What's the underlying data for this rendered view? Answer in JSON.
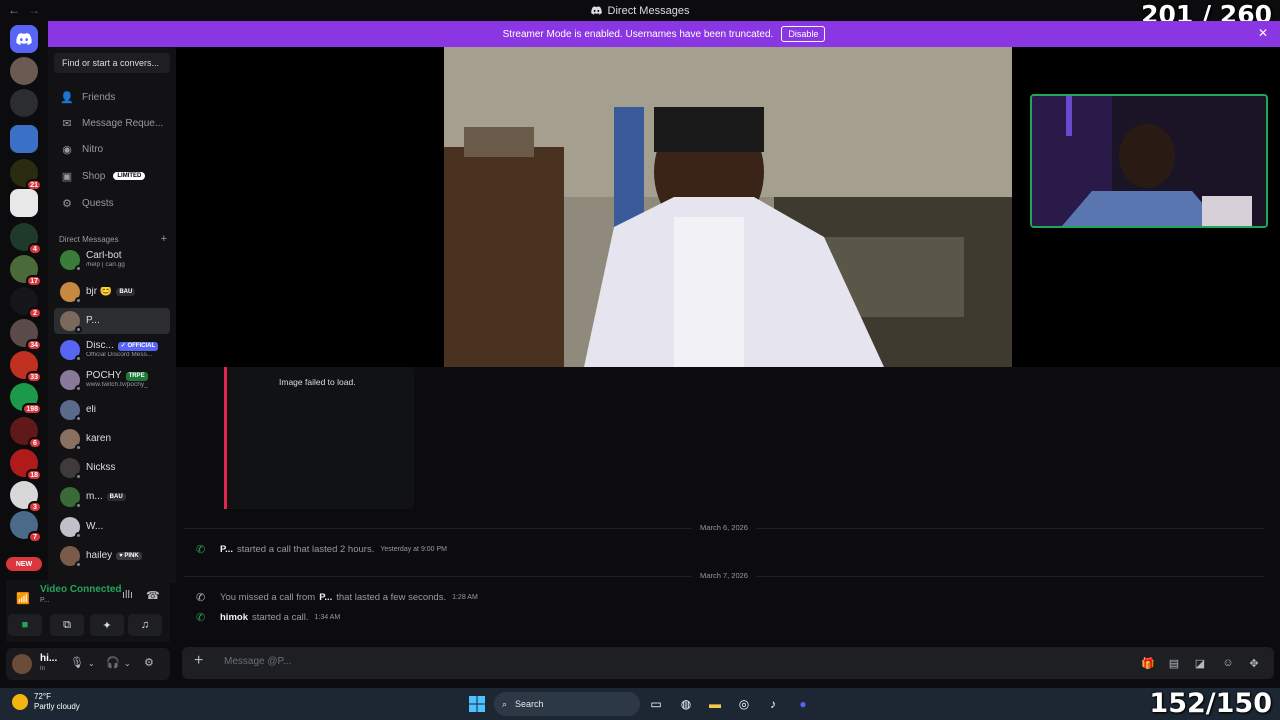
{
  "window": {
    "title": "Direct Messages"
  },
  "overlay": {
    "top_counter": "201 / 260",
    "bottom_counter": "152/150"
  },
  "banner": {
    "text": "Streamer Mode is enabled. Usernames have been truncated.",
    "button": "Disable"
  },
  "rail": {
    "badges": [
      "21",
      "4",
      "17",
      "2",
      "34",
      "33",
      "198",
      "6",
      "18",
      "3",
      "7"
    ],
    "new_label": "NEW"
  },
  "sidebar": {
    "search_placeholder": "Find or start a convers...",
    "nav": [
      {
        "label": "Friends",
        "icon": "friends-icon"
      },
      {
        "label": "Message Reque...",
        "icon": "envelope-icon"
      },
      {
        "label": "Nitro",
        "icon": "nitro-icon"
      },
      {
        "label": "Shop",
        "icon": "shop-icon",
        "badge": "LIMITED"
      },
      {
        "label": "Quests",
        "icon": "quests-icon"
      }
    ],
    "dm_header": "Direct Messages",
    "dms": [
      {
        "name": "Carl-bot",
        "sub": "/help | carl.gg",
        "color": "#3a7d3a"
      },
      {
        "name": "bjr 😊",
        "tag": "BAU",
        "tag_color": "#2b2d31",
        "color": "#c58a40"
      },
      {
        "name": "P...",
        "selected": true,
        "color": "#7a6a5e"
      },
      {
        "name": "Disc...",
        "tag": "✓ OFFICIAL",
        "tag_color": "#5865f2",
        "sub": "Official Discord Mess...",
        "color": "#5865f2"
      },
      {
        "name": "POCHY",
        "tag": "TRPE",
        "tag_color": "#1f7a3a",
        "sub": "www.twitch.tv/pochy_",
        "color": "#8a7a9a"
      },
      {
        "name": "eli",
        "color": "#5a6a8a"
      },
      {
        "name": "karen",
        "color": "#8a7060"
      },
      {
        "name": "Nickss",
        "color": "#403a3a"
      },
      {
        "name": "m...",
        "tag": "BAU",
        "tag_color": "#2b2d31",
        "color": "#3a6a3a"
      },
      {
        "name": "W...",
        "color": "#c0c0c8"
      },
      {
        "name": "hailey",
        "tag": "♥ PINK",
        "tag_color": "#3a3a3e",
        "color": "#7a5a4a"
      }
    ]
  },
  "voice": {
    "status": "Video Connected",
    "sub": "P..."
  },
  "user": {
    "name": "hi...",
    "status": "In"
  },
  "messages": {
    "image_failed": "Image failed to load.",
    "dates": [
      "March 6, 2026",
      "March 7, 2026"
    ],
    "system": [
      {
        "who": "P...",
        "text": " started a call that lasted 2 hours.",
        "time": "Yesterday at 9:00 PM"
      },
      {
        "pre": "You missed a call from ",
        "who": "P...",
        "text": " that lasted a few seconds.",
        "time": "1:28 AM"
      },
      {
        "who": "himok",
        "text": " started a call.",
        "time": "1:34 AM"
      }
    ]
  },
  "composer": {
    "placeholder": "Message @P..."
  },
  "taskbar": {
    "temp": "72°F",
    "weather": "Partly cloudy",
    "search": "Search"
  }
}
